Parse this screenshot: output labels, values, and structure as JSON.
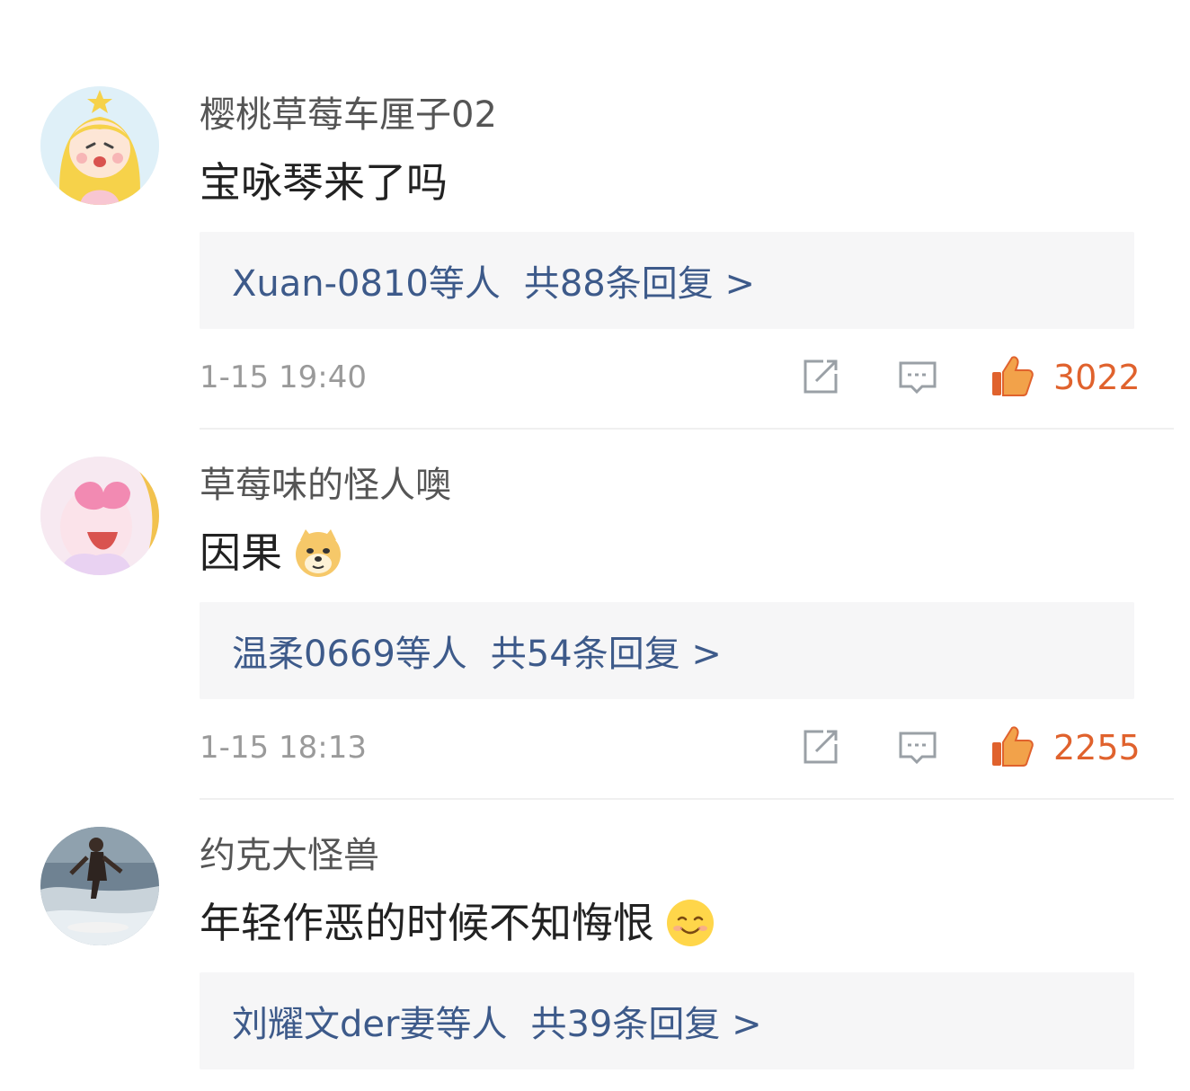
{
  "comments": [
    {
      "username": "樱桃草莓车厘子02",
      "text": "宝咏琴来了吗",
      "emoji": "",
      "reply_users": "Xuan-0810等人",
      "reply_count": "共88条回复 >",
      "time": "1-15 19:40",
      "likes": "3022"
    },
    {
      "username": "草莓味的怪人噢",
      "text": "因果",
      "emoji": "doge-emoji-icon",
      "reply_users": "温柔0669等人",
      "reply_count": "共54条回复 >",
      "time": "1-15 18:13",
      "likes": "2255"
    },
    {
      "username": "约克大怪兽",
      "text": "年轻作恶的时候不知悔恨",
      "emoji": "smile-emoji-icon",
      "reply_users": "刘耀文der妻等人",
      "reply_count": "共39条回复 >",
      "time": "",
      "likes": ""
    }
  ],
  "icons": {
    "share": "share-icon",
    "reply": "comment-bubble-icon",
    "like": "thumbs-up-icon"
  },
  "colors": {
    "link": "#3d5a8a",
    "like": "#e0622d",
    "reply_bg": "#f6f6f7"
  }
}
